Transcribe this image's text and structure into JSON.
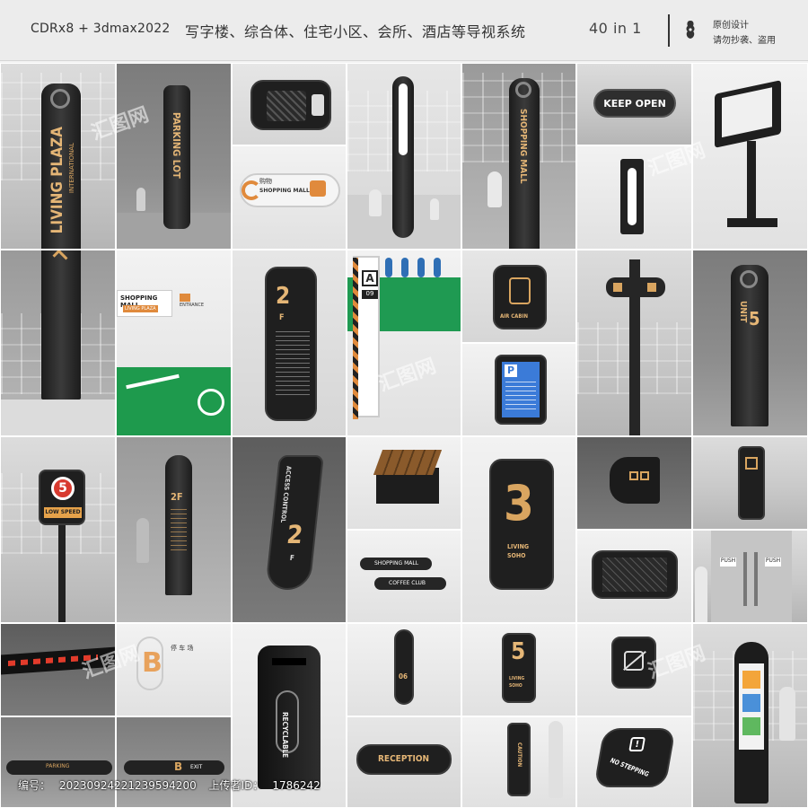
{
  "header": {
    "software": "CDRx8 + 3dmax2022",
    "title": "写字楼、综合体、住宅小区、会所、酒店等导视系统",
    "count": "40 in 1",
    "copyright_line1": "原创设计",
    "copyright_line2": "请勿抄袭、盗用"
  },
  "watermark": "汇图网",
  "tiles": {
    "living_plaza": {
      "line1": "LIVING PLAZA",
      "line2": "INTERNATIONAL"
    },
    "parking_lot": "PARKING LOT",
    "shopping_mall_wall": {
      "label": "SHOPPING MALL",
      "sub": "LIVING PLAZA",
      "entrance": "ENTRANCE"
    },
    "shopping_mall_small": {
      "cn": "购物",
      "en": "SHOPPING MALL"
    },
    "shopping_mall_totem": "SHOPPING MALL",
    "keep_open": "KEEP OPEN",
    "floor_directory": {
      "num": "2",
      "unit": "F"
    },
    "parking_column": {
      "letter": "A",
      "num": "09"
    },
    "air_cabin": "AIR CABIN",
    "parking_p": "P",
    "unit5": {
      "label": "UNIT",
      "num": "5"
    },
    "low_speed": {
      "num": "5",
      "label": "LOW SPEED"
    },
    "directory_2f": "2F",
    "access_control": {
      "label": "ACCESS CONTROL",
      "num": "2",
      "unit": "F"
    },
    "living_soho_big": {
      "num": "3",
      "line1": "LIVING",
      "line2": "SOHO"
    },
    "shopping_mall_plate": "SHOPPING MALL",
    "coffee_club": "COFFEE CLUB",
    "push": "PUSH",
    "floor_b": "B",
    "floor_b_cn": "停 车 场",
    "recyclable": "RECYCLABLE",
    "fire_tag": "06",
    "living_soho_small": {
      "num": "5",
      "line1": "LIVING",
      "line2": "SOHO"
    },
    "reception": "RECEPTION",
    "caution": "CAUTION",
    "no_stepping": "NO STEPPING",
    "exit": "EXIT",
    "parking_strip": "PARKING"
  },
  "footer": {
    "id_label": "编号：",
    "id_value": "20230924221239594200",
    "uploader_label": "上传者ID：",
    "uploader_value": "1786242"
  }
}
